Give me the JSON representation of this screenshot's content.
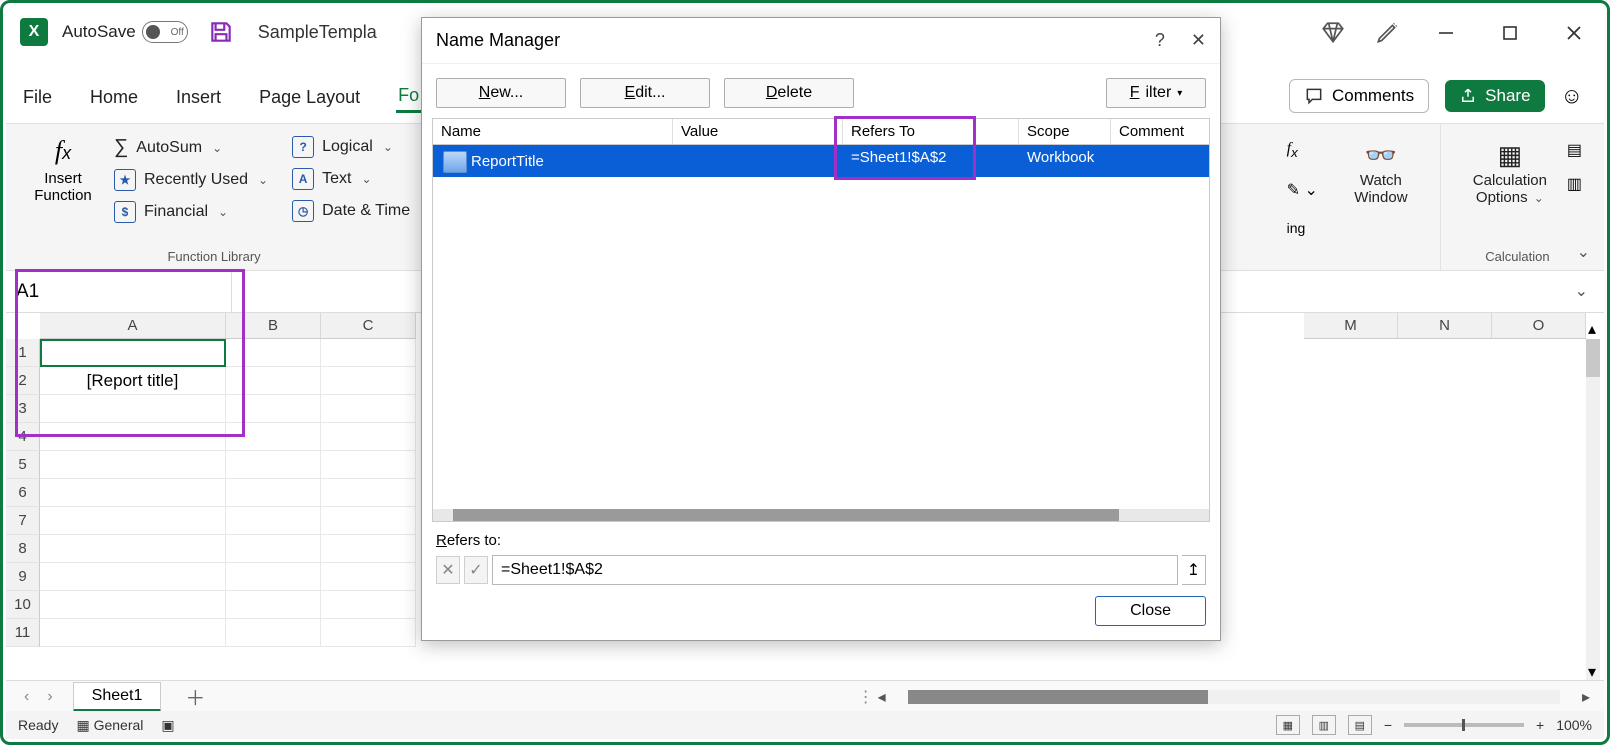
{
  "titlebar": {
    "autosave_label": "AutoSave",
    "autosave_state": "Off",
    "doc_title": "SampleTempla"
  },
  "tabs": {
    "file": "File",
    "home": "Home",
    "insert": "Insert",
    "page_layout": "Page Layout",
    "formulas": "Fo"
  },
  "actions": {
    "comments": "Comments",
    "share": "Share"
  },
  "ribbon": {
    "insert_function": "Insert Function",
    "autosum": "AutoSum",
    "recently_used": "Recently Used",
    "financial": "Financial",
    "logical": "Logical",
    "text": "Text",
    "date_time": "Date & Time",
    "group_label_lib": "Function Library",
    "watch_window": "Watch Window",
    "calc_options": "Calculation Options",
    "group_label_calc": "Calculation",
    "partial_ing": "ing"
  },
  "name_box": "A1",
  "columns": [
    "A",
    "B",
    "C",
    "M",
    "N",
    "O"
  ],
  "rows": [
    "1",
    "2",
    "3",
    "4",
    "5",
    "6",
    "7",
    "8",
    "9",
    "10",
    "11"
  ],
  "cell_a2": "[Report title]",
  "sheetbar": {
    "sheet1": "Sheet1"
  },
  "statusbar": {
    "ready": "Ready",
    "general": "General",
    "zoom": "100%"
  },
  "dialog": {
    "title": "Name Manager",
    "new": "New...",
    "edit": "Edit...",
    "delete": "Delete",
    "filter": "Filter",
    "col_name": "Name",
    "col_value": "Value",
    "col_refers": "Refers To",
    "col_scope": "Scope",
    "col_comment": "Comment",
    "row_name": "ReportTitle",
    "row_refers": "=Sheet1!$A$2",
    "row_scope": "Workbook",
    "refers_to_label": "Refers to:",
    "refers_to_value": "=Sheet1!$A$2",
    "close": "Close"
  }
}
